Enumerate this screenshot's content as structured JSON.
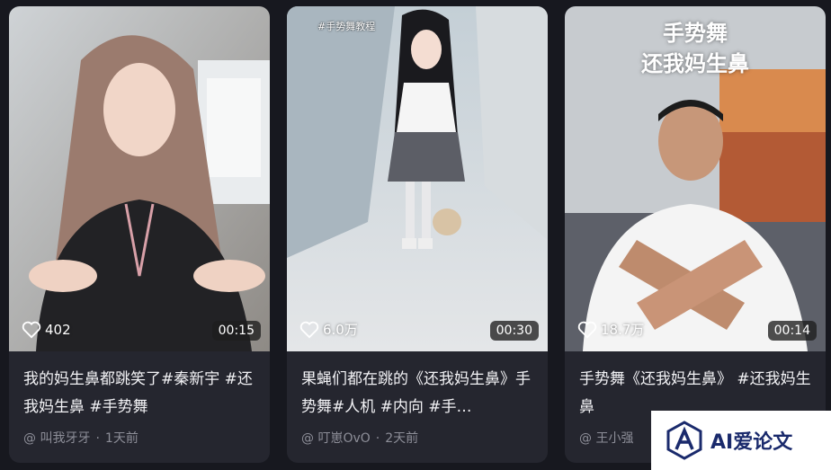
{
  "videos": [
    {
      "likes": "402",
      "duration": "00:15",
      "title": "我的妈生鼻都跳笑了#秦新宇 #还我妈生鼻 #手势舞",
      "author": "@ 叫我牙牙",
      "age": "1天前"
    },
    {
      "likes": "6.0万",
      "duration": "00:30",
      "overlay": "#手势舞教程",
      "title": "果蝇们都在跳的《还我妈生鼻》手势舞#人机 #内向 #手…",
      "author": "@ 叮崽OvO",
      "age": "2天前"
    },
    {
      "likes": "18.7万",
      "duration": "00:14",
      "overlay_line1": "手势舞",
      "overlay_line2": "还我妈生鼻",
      "title": "手势舞《还我妈生鼻》 #还我妈生鼻",
      "author": "@ 王小强"
    }
  ],
  "watermark": {
    "text": "AI爱论文"
  },
  "colors": {
    "background": "#17181f",
    "card": "#25262f",
    "title_text": "#f2f2f5",
    "meta_text": "#8d8e98"
  }
}
